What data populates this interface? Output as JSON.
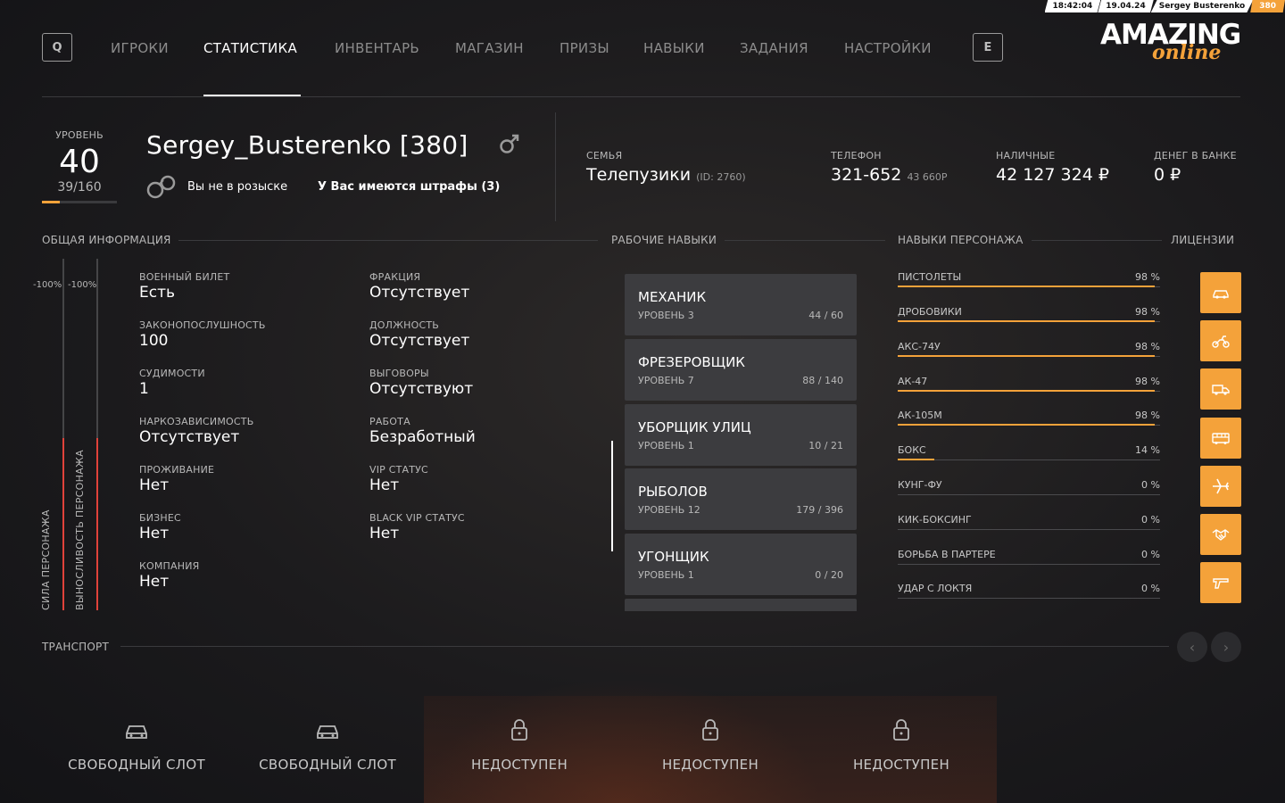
{
  "status_bar": {
    "time": "18:42:04",
    "date": "19.04.24",
    "player": "Sergey Busterenko",
    "level": "380"
  },
  "nav": {
    "left_key": "Q",
    "right_key": "E",
    "items": [
      "ИГРОКИ",
      "СТАТИСТИКА",
      "ИНВЕНТАРЬ",
      "МАГАЗИН",
      "ПРИЗЫ",
      "НАВЫКИ",
      "ЗАДАНИЯ",
      "НАСТРОЙКИ"
    ],
    "active": "СТАТИСТИКА"
  },
  "logo": {
    "main": "AMAZING",
    "sub": "online"
  },
  "profile": {
    "level_label": "УРОВЕНЬ",
    "level": "40",
    "xp": "39/160",
    "xp_fraction": 0.24,
    "name": "Sergey_Busterenko [380]",
    "wanted": "Вы не в розыске",
    "fines": "У Вас имеются штрафы (3)"
  },
  "stats": {
    "family_label": "СЕМЬЯ",
    "family": "Телепузики",
    "family_id": "(ID: 2760)",
    "phone_label": "ТЕЛЕФОН",
    "phone": "321-652",
    "phone_balance": "43 660Р",
    "cash_label": "НАЛИЧНЫЕ",
    "cash": "42 127 324 ₽",
    "bank_label": "ДЕНЕГ В БАНКЕ",
    "bank": "0 ₽"
  },
  "sections": {
    "general": "ОБЩАЯ ИНФОРМАЦИЯ",
    "jobs": "РАБОЧИЕ НАВЫКИ",
    "skills": "НАВЫКИ ПЕРСОНАЖА",
    "licenses": "ЛИЦЕНЗИИ",
    "transport": "ТРАНСПОРТ"
  },
  "bars": {
    "strength_label": "СИЛА ПЕРСОНАЖА",
    "strength_top": "-100%",
    "strength_fill": 0.49,
    "stamina_label": "ВЫНОСЛИВОСТЬ ПЕРСОНАЖА",
    "stamina_top": "-100%",
    "stamina_fill": 0.49
  },
  "info": [
    {
      "k": "ВОЕННЫЙ БИЛЕТ",
      "v": "Есть"
    },
    {
      "k": "ЗАКОНОПОСЛУШНОСТЬ",
      "v": "100"
    },
    {
      "k": "СУДИМОСТИ",
      "v": "1"
    },
    {
      "k": "НАРКОЗАВИСИМОСТЬ",
      "v": "Отсутствует"
    },
    {
      "k": "ПРОЖИВАНИЕ",
      "v": "Нет"
    },
    {
      "k": "БИЗНЕС",
      "v": "Нет"
    },
    {
      "k": "КОМПАНИЯ",
      "v": "Нет"
    },
    {
      "k": "ФРАКЦИЯ",
      "v": "Отсутствует"
    },
    {
      "k": "ДОЛЖНОСТЬ",
      "v": "Отсутствует"
    },
    {
      "k": "ВЫГОВОРЫ",
      "v": "Отсутствуют"
    },
    {
      "k": "РАБОТА",
      "v": "Безработный"
    },
    {
      "k": "VIP СТАТУС",
      "v": "Нет"
    },
    {
      "k": "BLACK VIP СТАТУС",
      "v": "Нет"
    }
  ],
  "jobs": [
    {
      "name": "МЕХАНИК",
      "level": "УРОВЕНЬ 3",
      "progress": "44 / 60"
    },
    {
      "name": "ФРЕЗЕРОВЩИК",
      "level": "УРОВЕНЬ 7",
      "progress": "88 / 140"
    },
    {
      "name": "УБОРЩИК УЛИЦ",
      "level": "УРОВЕНЬ 1",
      "progress": "10 / 21"
    },
    {
      "name": "РЫБОЛОВ",
      "level": "УРОВЕНЬ 12",
      "progress": "179 / 396"
    },
    {
      "name": "УГОНЩИК",
      "level": "УРОВЕНЬ 1",
      "progress": "0 / 20"
    }
  ],
  "skills": [
    {
      "name": "ПИСТОЛЕТЫ",
      "pct": "98 %",
      "value": 98
    },
    {
      "name": "ДРОБОВИКИ",
      "pct": "98 %",
      "value": 98
    },
    {
      "name": "АКС-74У",
      "pct": "98 %",
      "value": 98
    },
    {
      "name": "АК-47",
      "pct": "98 %",
      "value": 98
    },
    {
      "name": "АК-105М",
      "pct": "98 %",
      "value": 98
    },
    {
      "name": "БОКС",
      "pct": "14 %",
      "value": 14
    },
    {
      "name": "КУНГ-ФУ",
      "pct": "0 %",
      "value": 0
    },
    {
      "name": "КИК-БОКСИНГ",
      "pct": "0 %",
      "value": 0
    },
    {
      "name": "БОРЬБА В ПАРТЕРЕ",
      "pct": "0 %",
      "value": 0
    },
    {
      "name": "УДАР С ЛОКТЯ",
      "pct": "0 %",
      "value": 0
    }
  ],
  "licenses": [
    "car-icon",
    "moto-icon",
    "truck-icon",
    "bus-icon",
    "plane-icon",
    "handshake-icon",
    "gun-icon"
  ],
  "transport": {
    "prev": "‹",
    "next": "›",
    "slots": [
      {
        "label": "СВОБОДНЫЙ СЛОТ",
        "icon": "car-icon",
        "locked": false
      },
      {
        "label": "СВОБОДНЫЙ СЛОТ",
        "icon": "car-icon",
        "locked": false
      },
      {
        "label": "НЕДОСТУПЕН",
        "icon": "lock-icon",
        "locked": true
      },
      {
        "label": "НЕДОСТУПЕН",
        "icon": "lock-icon",
        "locked": true
      },
      {
        "label": "НЕДОСТУПЕН",
        "icon": "lock-icon",
        "locked": true
      }
    ]
  },
  "colors": {
    "accent": "#f4a23a",
    "bar_red": "#e0423a",
    "card": "#3c3c3f"
  }
}
